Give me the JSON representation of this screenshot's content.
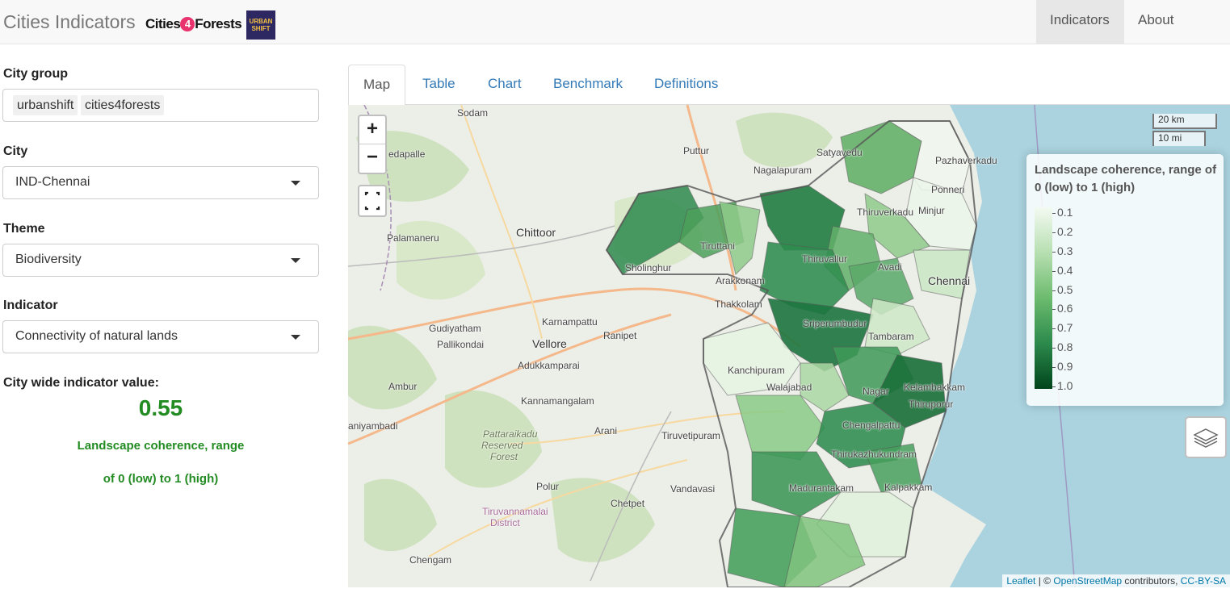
{
  "navbar": {
    "title": "Cities Indicators",
    "logo_c4f_left": "Cities",
    "logo_c4f_num": "4",
    "logo_c4f_right": "Forests",
    "logo_us_line1": "URBAN",
    "logo_us_line2": "SHIFT",
    "nav_indicators": "Indicators",
    "nav_about": "About"
  },
  "sidebar": {
    "city_group_label": "City group",
    "city_group_chips": [
      "urbanshift",
      "cities4forests"
    ],
    "city_label": "City",
    "city_value": "IND-Chennai",
    "theme_label": "Theme",
    "theme_value": "Biodiversity",
    "indicator_label": "Indicator",
    "indicator_value": "Connectivity of natural lands",
    "city_wide_label": "City wide indicator value:",
    "city_wide_value": "0.55",
    "indicator_desc_1": "Landscape coherence, range",
    "indicator_desc_2": "of 0 (low) to 1 (high)"
  },
  "tabs": [
    "Map",
    "Table",
    "Chart",
    "Benchmark",
    "Definitions"
  ],
  "active_tab": "Map",
  "map": {
    "zoom_in": "+",
    "zoom_out": "−",
    "scale_km": "20 km",
    "scale_mi": "10 mi",
    "places": [
      {
        "name": "Sodam"
      },
      {
        "name": "Puttur"
      },
      {
        "name": "Satyavedu"
      },
      {
        "name": "Pazhaverkadu"
      },
      {
        "name": "Nagalapuram"
      },
      {
        "name": "edapalle"
      },
      {
        "name": "Chittoor"
      },
      {
        "name": "Palamaneru"
      },
      {
        "name": "Tiruttani"
      },
      {
        "name": "Sholinghur"
      },
      {
        "name": "Arakkonam"
      },
      {
        "name": "Thiruvallur"
      },
      {
        "name": "Avadi"
      },
      {
        "name": "Chennai"
      },
      {
        "name": "Thakkolam"
      },
      {
        "name": "Sriperumbudur"
      },
      {
        "name": "Tambaram"
      },
      {
        "name": "Karnampattu"
      },
      {
        "name": "Ranipet"
      },
      {
        "name": "Gudiyatham"
      },
      {
        "name": "Pallikondai"
      },
      {
        "name": "Vellore"
      },
      {
        "name": "Adukkamparai"
      },
      {
        "name": "Kanchipuram"
      },
      {
        "name": "Walajabad"
      },
      {
        "name": "Nagar"
      },
      {
        "name": "Kelambakkam"
      },
      {
        "name": "Thiruporur"
      },
      {
        "name": "Chengalpattu"
      },
      {
        "name": "Ambur"
      },
      {
        "name": "Kannamangalam"
      },
      {
        "name": "aniyambadi"
      },
      {
        "name": "Pattaraikadu"
      },
      {
        "name": "Reserved"
      },
      {
        "name": "Forest"
      },
      {
        "name": "Arani"
      },
      {
        "name": "Tiruvetipuram"
      },
      {
        "name": "Thirukazhukundram"
      },
      {
        "name": "Madurantakam"
      },
      {
        "name": "Kalpakkam"
      },
      {
        "name": "Polur"
      },
      {
        "name": "Vandavasi"
      },
      {
        "name": "Chetpet"
      },
      {
        "name": "Tiruvannamalai"
      },
      {
        "name": "District"
      },
      {
        "name": "Chengam"
      },
      {
        "name": "Thiruverkadu"
      },
      {
        "name": "Ponneri"
      },
      {
        "name": "Minjur"
      }
    ],
    "legend": {
      "title": "Landscape coherence, range of 0 (low) to 1 (high)",
      "labels": [
        "0.1",
        "0.2",
        "0.3",
        "0.4",
        "0.5",
        "0.6",
        "0.7",
        "0.8",
        "0.9",
        "1.0"
      ],
      "color_low": "#f4faf2",
      "color_high": "#00441b"
    },
    "attribution": {
      "leaflet": "Leaflet",
      "sep": " | © ",
      "osm": "OpenStreetMap",
      "contrib": " contributors, ",
      "license": "CC-BY-SA"
    }
  }
}
